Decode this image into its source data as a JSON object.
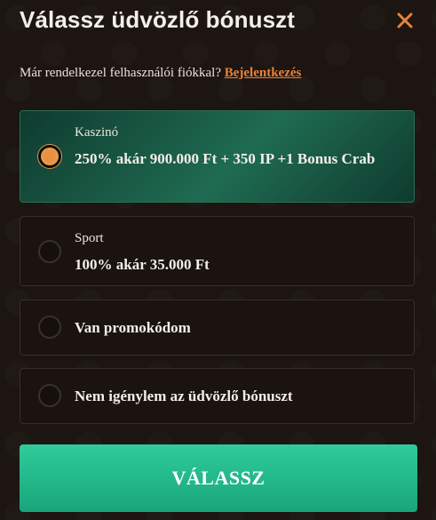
{
  "header": {
    "title": "Válassz üdvözlő bónuszt",
    "close_icon": "close-icon"
  },
  "login": {
    "prompt": "Már rendelkezel felhasználói fiókkal?",
    "link": "Bejelentkezés"
  },
  "options": [
    {
      "category": "Kaszinó",
      "label": "250% akár 900.000 Ft + 350 IP +1 Bonus Crab",
      "selected": true
    },
    {
      "category": "Sport",
      "label": "100% akár 35.000 Ft",
      "selected": false
    },
    {
      "category": "",
      "label": "Van promokódom",
      "selected": false
    },
    {
      "category": "",
      "label": "Nem igénylem az üdvözlő bónuszt",
      "selected": false
    }
  ],
  "submit": {
    "label": "VÁLASSZ"
  },
  "colors": {
    "accent": "#e8823a",
    "selected_bg": "#1f6b52",
    "button": "#2fcc9b",
    "background": "#1c1511"
  }
}
